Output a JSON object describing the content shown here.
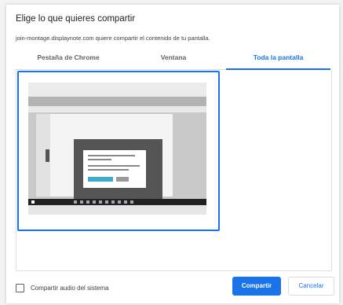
{
  "dialog": {
    "title": "Elige lo que quieres compartir",
    "subtitle": "join-montage.displaynote.com quiere compartir el contenido de tu pantalla."
  },
  "tabs": [
    {
      "label": "Pestaña de Chrome",
      "selected": false
    },
    {
      "label": "Ventana",
      "selected": false
    },
    {
      "label": "Toda la pantalla",
      "selected": true
    }
  ],
  "footer": {
    "checkbox_label": "Compartir audio del sistema",
    "checkbox_checked": false,
    "share_label": "Compartir",
    "cancel_label": "Cancelar"
  },
  "colors": {
    "accent": "#1a73e8",
    "text": "#202124",
    "muted": "#5f6368"
  }
}
